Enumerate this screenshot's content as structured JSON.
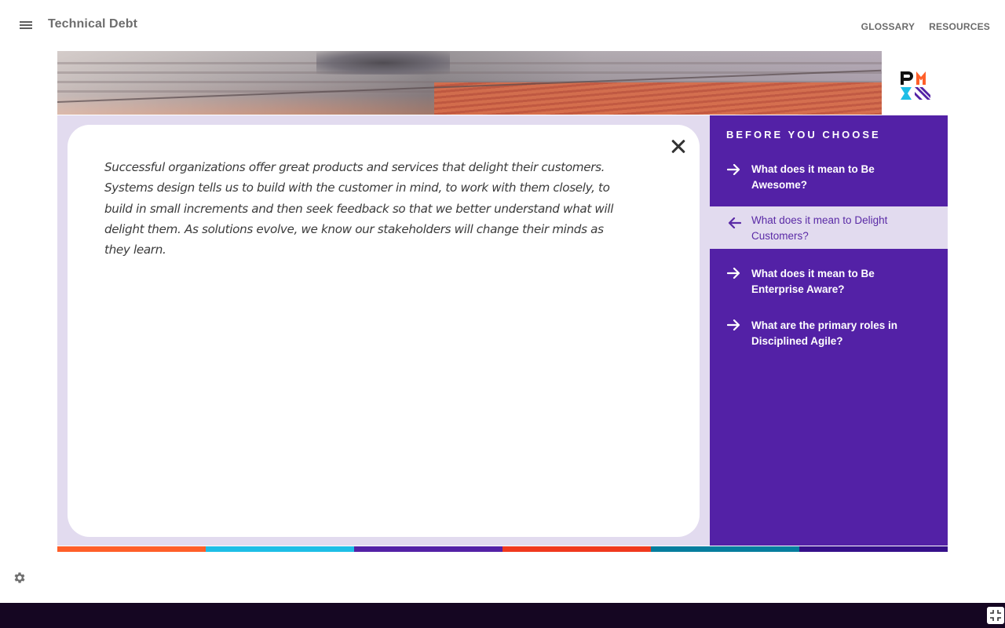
{
  "header": {
    "title": "Technical Debt",
    "links": [
      "GLOSSARY",
      "RESOURCES"
    ],
    "menu_icon": "hamburger-menu-icon"
  },
  "content": {
    "body": "Successful organizations offer great products and services that delight their customers. Systems design tells us to build with the customer in mind, to work with them closely, to build in small increments and then seek feedback so that we better understand what will delight them. As solutions evolve, we know our stakeholders will change their minds as they learn.",
    "close_icon": "close-icon"
  },
  "sidebar": {
    "title": "BEFORE YOU CHOOSE",
    "items": [
      {
        "label": "What does it mean to Be Awesome?",
        "icon": "arrow-right-icon",
        "active": false
      },
      {
        "label": "What does it mean to Delight Customers?",
        "icon": "arrow-left-icon",
        "active": true
      },
      {
        "label": "What does it mean to Be Enterprise Aware?",
        "icon": "arrow-right-icon",
        "active": false
      },
      {
        "label": "What are the primary roles in Disciplined Agile?",
        "icon": "arrow-right-icon",
        "active": false
      }
    ]
  },
  "brand": {
    "logo_text": "PMI"
  },
  "colors": {
    "accent": "#5321a6",
    "accent_light": "#e2dbef",
    "strip": [
      "#ff5f29",
      "#1ebee6",
      "#5321a6",
      "#f0391e",
      "#067d9e",
      "#36108a"
    ],
    "bottom_bar": "#150622"
  },
  "footer": {
    "settings_icon": "gear-icon",
    "fullscreen_icon": "exit-fullscreen-icon"
  }
}
